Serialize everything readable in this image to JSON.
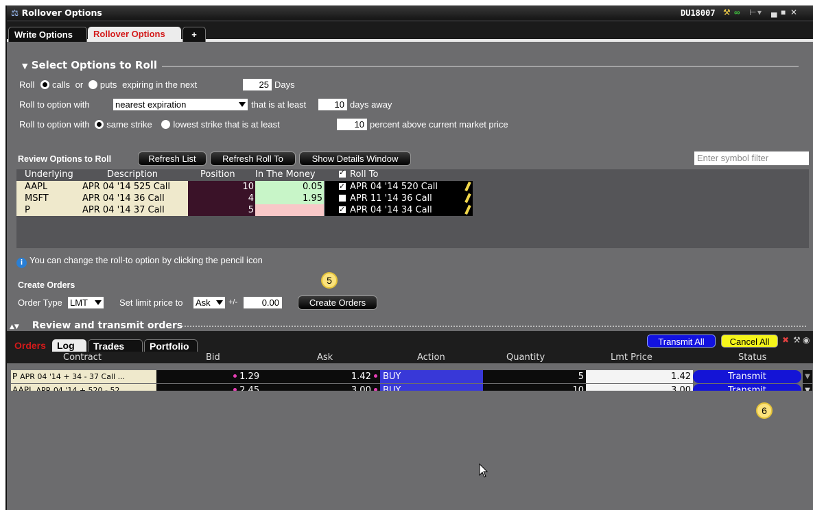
{
  "window": {
    "title": "Rollover Options",
    "account": "DU18007"
  },
  "tabs": [
    {
      "label": "Write Options"
    },
    {
      "label": "Rollover Options"
    },
    {
      "label": "+"
    }
  ],
  "select_section": {
    "title": "Select Options to Roll",
    "roll_label": "Roll",
    "calls_label": "calls",
    "or_label": "or",
    "puts_label": "puts",
    "expiring_label": "expiring in the next",
    "days_value": "25",
    "days_label": "Days",
    "roll_to_label": "Roll to option with",
    "expiration_option": "nearest expiration",
    "at_least_label": "that is at least",
    "days_away_value": "10",
    "days_away_label": "days away",
    "same_strike_label": "same strike",
    "lowest_strike_label": "lowest strike that is at least",
    "percent_value": "10",
    "percent_label": "percent above current market price"
  },
  "review": {
    "title": "Review Options to Roll",
    "refresh_list": "Refresh List",
    "refresh_roll_to": "Refresh Roll To",
    "show_details": "Show Details Window",
    "filter_placeholder": "Enter symbol filter",
    "columns": [
      "Underlying",
      "Description",
      "Position",
      "In The Money",
      "Roll To"
    ],
    "rows": [
      {
        "underlying": "AAPL",
        "description": "APR 04 '14 525 Call",
        "position": "10",
        "itm": "0.05",
        "roll_checked": true,
        "roll_to": "APR 04 '14 520 Call"
      },
      {
        "underlying": "MSFT",
        "description": "APR 04 '14 36 Call",
        "position": "4",
        "itm": "1.95",
        "roll_checked": false,
        "roll_to": "APR 11 '14 36 Call"
      },
      {
        "underlying": "P",
        "description": "APR 04 '14 37 Call",
        "position": "5",
        "itm": "",
        "roll_checked": true,
        "roll_to": "APR 04 '14 34 Call"
      }
    ]
  },
  "info_text": "You can change the roll-to option by clicking the pencil icon",
  "create_orders": {
    "title": "Create Orders",
    "order_type_label": "Order Type",
    "order_type": "LMT",
    "limit_label": "Set limit price to",
    "limit_value": "Ask",
    "plusminus": "+/-",
    "offset": "0.00",
    "button": "Create Orders",
    "step_badge": "5"
  },
  "transmit_section": {
    "title": "Review and transmit orders",
    "tabs": [
      "Orders",
      "Log",
      "Trades",
      "Portfolio"
    ],
    "transmit_all": "Transmit All",
    "cancel_all": "Cancel All",
    "columns": [
      "Contract",
      "Bid",
      "Ask",
      "Action",
      "Quantity",
      "Lmt Price",
      "Status"
    ],
    "rows": [
      {
        "sym": "P",
        "contract": "APR 04 '14 + 34 - 37 Call ...",
        "bid": "1.29",
        "ask": "1.42",
        "action": "BUY",
        "qty": "5",
        "lmt": "1.42",
        "status": "Transmit"
      },
      {
        "sym": "AAPL",
        "contract": "APR 04 '14 + 520 - 52...",
        "bid": "2.45",
        "ask": "3.00",
        "action": "BUY",
        "qty": "10",
        "lmt": "3.00",
        "status": "Transmit"
      }
    ],
    "step_badge": "6"
  }
}
